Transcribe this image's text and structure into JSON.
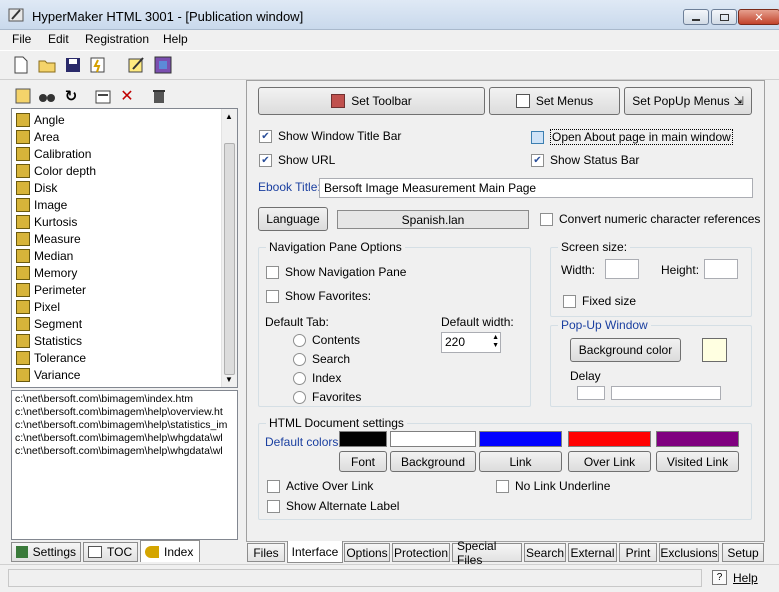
{
  "window": {
    "title": "HyperMaker HTML 3001 - [Publication window]"
  },
  "menu": {
    "file": "File",
    "edit": "Edit",
    "registration": "Registration",
    "help": "Help"
  },
  "index_list": [
    "Angle",
    "Area",
    "Calibration",
    "Color depth",
    "Disk",
    "Image",
    "Kurtosis",
    "Measure",
    "Median",
    "Memory",
    "Perimeter",
    "Pixel",
    "Segment",
    "Statistics",
    "Tolerance",
    "Variance"
  ],
  "urls": [
    "c:\\net\\bersoft.com\\bimagem\\index.htm",
    "c:\\net\\bersoft.com\\bimagem\\help\\overview.ht",
    "c:\\net\\bersoft.com\\bimagem\\help\\statistics_im",
    "c:\\net\\bersoft.com\\bimagem\\help\\whgdata\\wl",
    "c:\\net\\bersoft.com\\bimagem\\help\\whgdata\\wl"
  ],
  "left_tabs": {
    "settings": "Settings",
    "toc": "TOC",
    "index": "Index"
  },
  "buttons": {
    "set_toolbar": "Set Toolbar",
    "set_menus": "Set Menus",
    "set_popup": "Set PopUp Menus",
    "language": "Language",
    "bg_color": "Background color"
  },
  "options": {
    "show_title_bar": "Show Window Title Bar",
    "open_about": "Open About page in main window",
    "show_url": "Show URL",
    "show_status_bar": "Show Status Bar",
    "ebook_title_label": "Ebook Title:",
    "ebook_title_value": "Bersoft Image Measurement Main Page",
    "language_file": "Spanish.lan",
    "convert_numeric": "Convert numeric character references"
  },
  "nav_pane": {
    "title": "Navigation Pane Options",
    "show_nav": "Show Navigation Pane",
    "show_fav": "Show Favorites:",
    "default_tab": "Default Tab:",
    "tabs": [
      "Contents",
      "Search",
      "Index",
      "Favorites"
    ],
    "default_width_label": "Default width:",
    "default_width_value": "220"
  },
  "screen": {
    "title": "Screen size:",
    "width": "Width:",
    "height": "Height:",
    "fixed": "Fixed size"
  },
  "popup": {
    "title": "Pop-Up Window",
    "delay": "Delay"
  },
  "html_settings": {
    "title": "HTML Document settings",
    "default_colors": "Default colors:",
    "buttons": [
      "Font",
      "Background",
      "Link",
      "Over Link",
      "Visited Link"
    ],
    "colors": [
      "#000000",
      "#ffffff",
      "#0000ff",
      "#ff0000",
      "#800080"
    ],
    "active_over": "Active Over Link",
    "no_underline": "No Link Underline",
    "alt_label": "Show Alternate Label"
  },
  "bottom_tabs": [
    "Files",
    "Interface",
    "Options",
    "Protection",
    "Special Files",
    "Search",
    "External",
    "Print",
    "Exclusions",
    "Setup"
  ],
  "status": {
    "help": "Help"
  }
}
